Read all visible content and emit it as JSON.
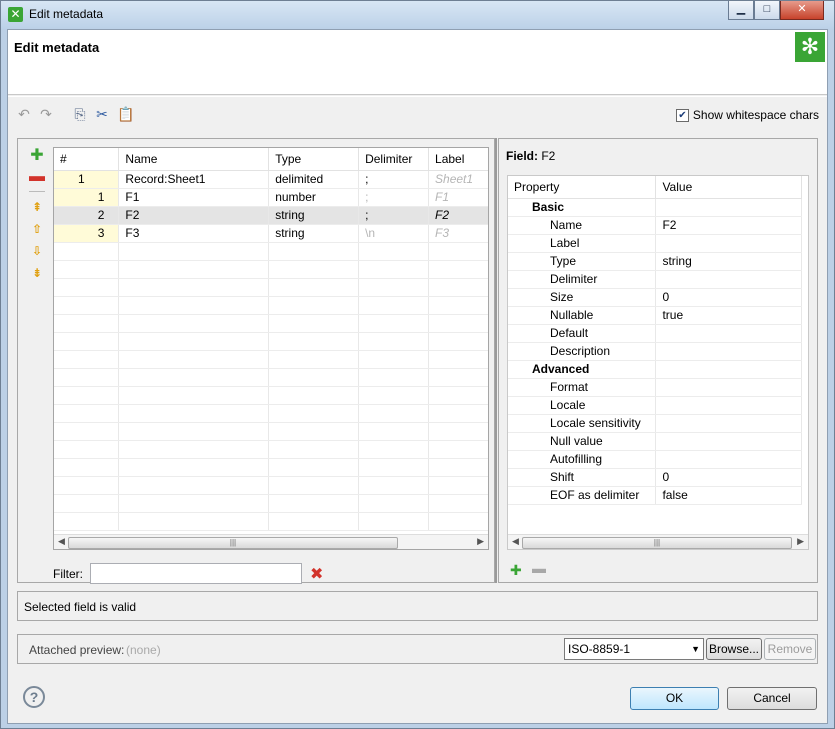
{
  "window": {
    "title": "Edit metadata",
    "header": "Edit metadata"
  },
  "toolbar": {
    "show_whitespace_label": "Show whitespace chars",
    "show_whitespace_checked": true
  },
  "fields_table": {
    "columns": [
      "#",
      "Name",
      "Type",
      "Delimiter",
      "Label"
    ],
    "rows": [
      {
        "num": "1",
        "name": "Record:Sheet1",
        "type": "delimited",
        "delimiter": ";",
        "label": "Sheet1",
        "indent": false
      },
      {
        "num": "1",
        "name": "F1",
        "type": "number",
        "delimiter": ";",
        "label": "F1",
        "indent": true
      },
      {
        "num": "2",
        "name": "F2",
        "type": "string",
        "delimiter": ";",
        "label": "F2",
        "indent": true,
        "selected": true
      },
      {
        "num": "3",
        "name": "F3",
        "type": "string",
        "delimiter": "\\n",
        "label": "F3",
        "indent": true
      }
    ]
  },
  "filter": {
    "label": "Filter:",
    "value": ""
  },
  "field_panel": {
    "title_prefix": "Field:",
    "title_value": "F2",
    "columns": [
      "Property",
      "Value"
    ],
    "rows": [
      {
        "group": "Basic"
      },
      {
        "property": "Name",
        "value": "F2"
      },
      {
        "property": "Label",
        "value": ""
      },
      {
        "property": "Type",
        "value": "string"
      },
      {
        "property": "Delimiter",
        "value": ""
      },
      {
        "property": "Size",
        "value": "0"
      },
      {
        "property": "Nullable",
        "value": "true"
      },
      {
        "property": "Default",
        "value": ""
      },
      {
        "property": "Description",
        "value": ""
      },
      {
        "group": "Advanced"
      },
      {
        "property": "Format",
        "value": ""
      },
      {
        "property": "Locale",
        "value": ""
      },
      {
        "property": "Locale sensitivity",
        "value": ""
      },
      {
        "property": "Null value",
        "value": ""
      },
      {
        "property": "Autofilling",
        "value": ""
      },
      {
        "property": "Shift",
        "value": "0"
      },
      {
        "property": "EOF as delimiter",
        "value": "false"
      }
    ]
  },
  "status": {
    "message": "Selected field is valid"
  },
  "preview": {
    "label": "Attached preview:",
    "value": "(none)",
    "encoding": "ISO-8859-1",
    "browse": "Browse...",
    "remove": "Remove"
  },
  "buttons": {
    "ok": "OK",
    "cancel": "Cancel"
  },
  "colors": {
    "accent": "#3aa535",
    "selected_row": "#e4e4e4",
    "number_cell": "#fffbd8",
    "delete": "#d2332b"
  }
}
